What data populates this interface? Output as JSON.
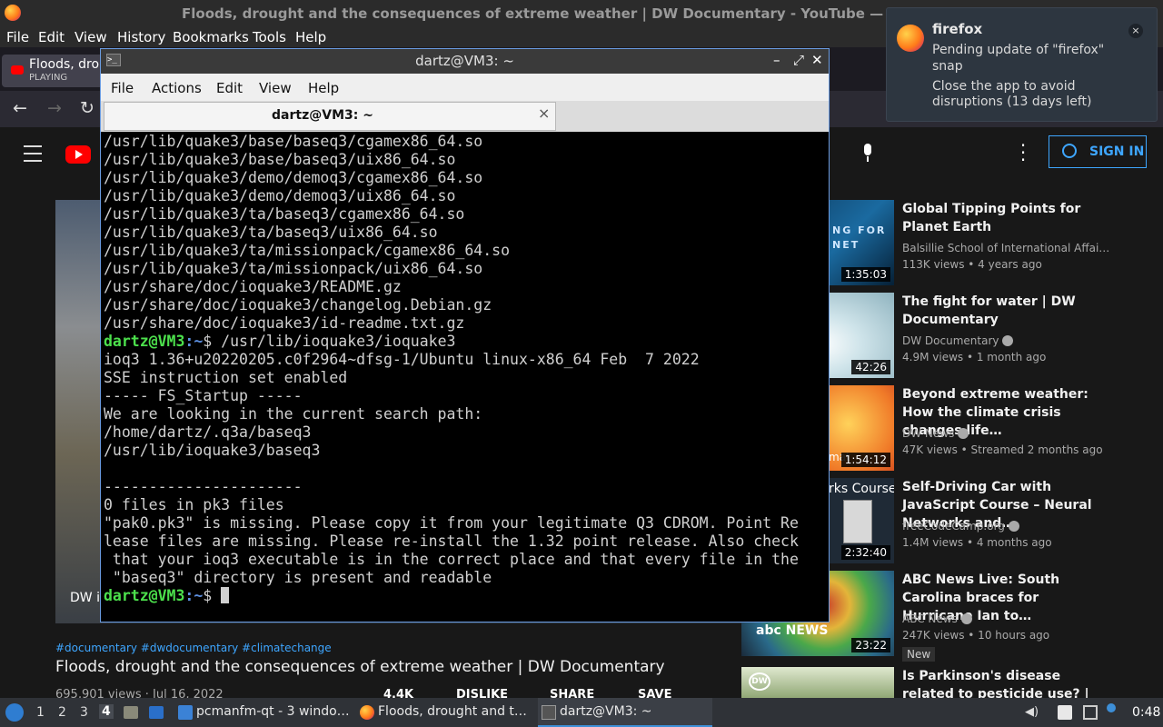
{
  "firefox": {
    "window_title": "Floods, drought and the consequences of extreme weather | DW Documentary - YouTube — Mozilla Firefox",
    "menu": [
      "File",
      "Edit",
      "View",
      "History",
      "Bookmarks",
      "Tools",
      "Help"
    ],
    "tab": {
      "title": "Floods, drou",
      "status": "PLAYING"
    },
    "nav_icons": [
      "back-icon",
      "forward-icon",
      "reload-icon"
    ]
  },
  "youtube": {
    "sign_in": "SIGN IN",
    "video": {
      "caption": "DW is",
      "hashtags": "#documentary #dwdocumentary #climatechange",
      "title": "Floods, drought and the consequences of extreme weather | DW Documentary",
      "views_date": "695,901 views · Jul 16, 2022",
      "likes": "4.4K",
      "dislike": "DISLIKE",
      "share": "SHARE",
      "save": "SAVE"
    },
    "recommendations": [
      {
        "title": "Global Tipping Points for Planet Earth",
        "channel": "Balsillie School of International Affai…",
        "stats": "113K views • 4 years ago",
        "duration": "1:35:03",
        "thumb_text": "NG FOR NET",
        "verified": false
      },
      {
        "title": "The fight for water | DW Documentary",
        "channel": "DW Documentary",
        "stats": "4.9M views • 1 month ago",
        "duration": "42:26",
        "verified": true
      },
      {
        "title": "Beyond extreme weather: How the climate crisis changes life…",
        "channel": "DW News",
        "stats": "47K views • Streamed 2 months ago",
        "duration": "1:54:12",
        "thumb_text": "mat",
        "verified": true
      },
      {
        "title": "Self-Driving Car with JavaScript Course – Neural Networks and…",
        "channel": "freeCodeCamp.org",
        "stats": "1.4M views • 4 months ago",
        "duration": "2:32:40",
        "thumb_text": "rks Course",
        "verified": true
      },
      {
        "title": "ABC News Live: South Carolina braces for Hurricane Ian to…",
        "channel": "ABC News",
        "stats": "247K views • 10 hours ago",
        "duration": "23:22",
        "badge": "New",
        "thumb_text": "abc NEWS",
        "verified": true
      },
      {
        "title": "Is Parkinson's disease related to pesticide use? | DW…",
        "thumb_text": "DW"
      }
    ]
  },
  "notification": {
    "app": "firefox",
    "lines": [
      "Pending update of \"firefox\"",
      "snap",
      "Close the app to avoid",
      "disruptions (13 days left)"
    ],
    "close": "×"
  },
  "terminal": {
    "window_title": "dartz@VM3: ~",
    "menu": [
      "File",
      "Actions",
      "Edit",
      "View",
      "Help"
    ],
    "tab_title": "dartz@VM3: ~",
    "tab_close": "×",
    "prompt_user": "dartz@VM3",
    "prompt_path": ":~",
    "prompt_symbol": "$ ",
    "lines": [
      "/usr/lib/quake3/base/baseq3/cgamex86_64.so",
      "/usr/lib/quake3/base/baseq3/uix86_64.so",
      "/usr/lib/quake3/demo/demoq3/cgamex86_64.so",
      "/usr/lib/quake3/demo/demoq3/uix86_64.so",
      "/usr/lib/quake3/ta/baseq3/cgamex86_64.so",
      "/usr/lib/quake3/ta/baseq3/uix86_64.so",
      "/usr/lib/quake3/ta/missionpack/cgamex86_64.so",
      "/usr/lib/quake3/ta/missionpack/uix86_64.so",
      "/usr/share/doc/ioquake3/README.gz",
      "/usr/share/doc/ioquake3/changelog.Debian.gz",
      "/usr/share/doc/ioquake3/id-readme.txt.gz"
    ],
    "command": "/usr/lib/ioquake3/ioquake3",
    "output": [
      "ioq3 1.36+u20220205.c0f2964~dfsg-1/Ubuntu linux-x86_64 Feb  7 2022",
      "SSE instruction set enabled",
      "----- FS_Startup -----",
      "We are looking in the current search path:",
      "/home/dartz/.q3a/baseq3",
      "/usr/lib/ioquake3/baseq3",
      "",
      "----------------------",
      "0 files in pk3 files",
      "\"pak0.pk3\" is missing. Please copy it from your legitimate Q3 CDROM. Point Re",
      "lease files are missing. Please re-install the 1.32 point release. Also check",
      " that your ioq3 executable is in the correct place and that every file in the",
      " \"baseq3\" directory is present and readable"
    ]
  },
  "taskbar": {
    "workspaces": [
      "1",
      "2",
      "3",
      "4"
    ],
    "active_workspace": "4",
    "tasks": [
      {
        "label": "pcmanfm-qt - 3 windo…",
        "icon": "folder-icon"
      },
      {
        "label": "Floods, drought and t…",
        "icon": "firefox-icon"
      },
      {
        "label": "dartz@VM3: ~",
        "icon": "terminal-icon"
      }
    ],
    "clock": "0:48"
  }
}
